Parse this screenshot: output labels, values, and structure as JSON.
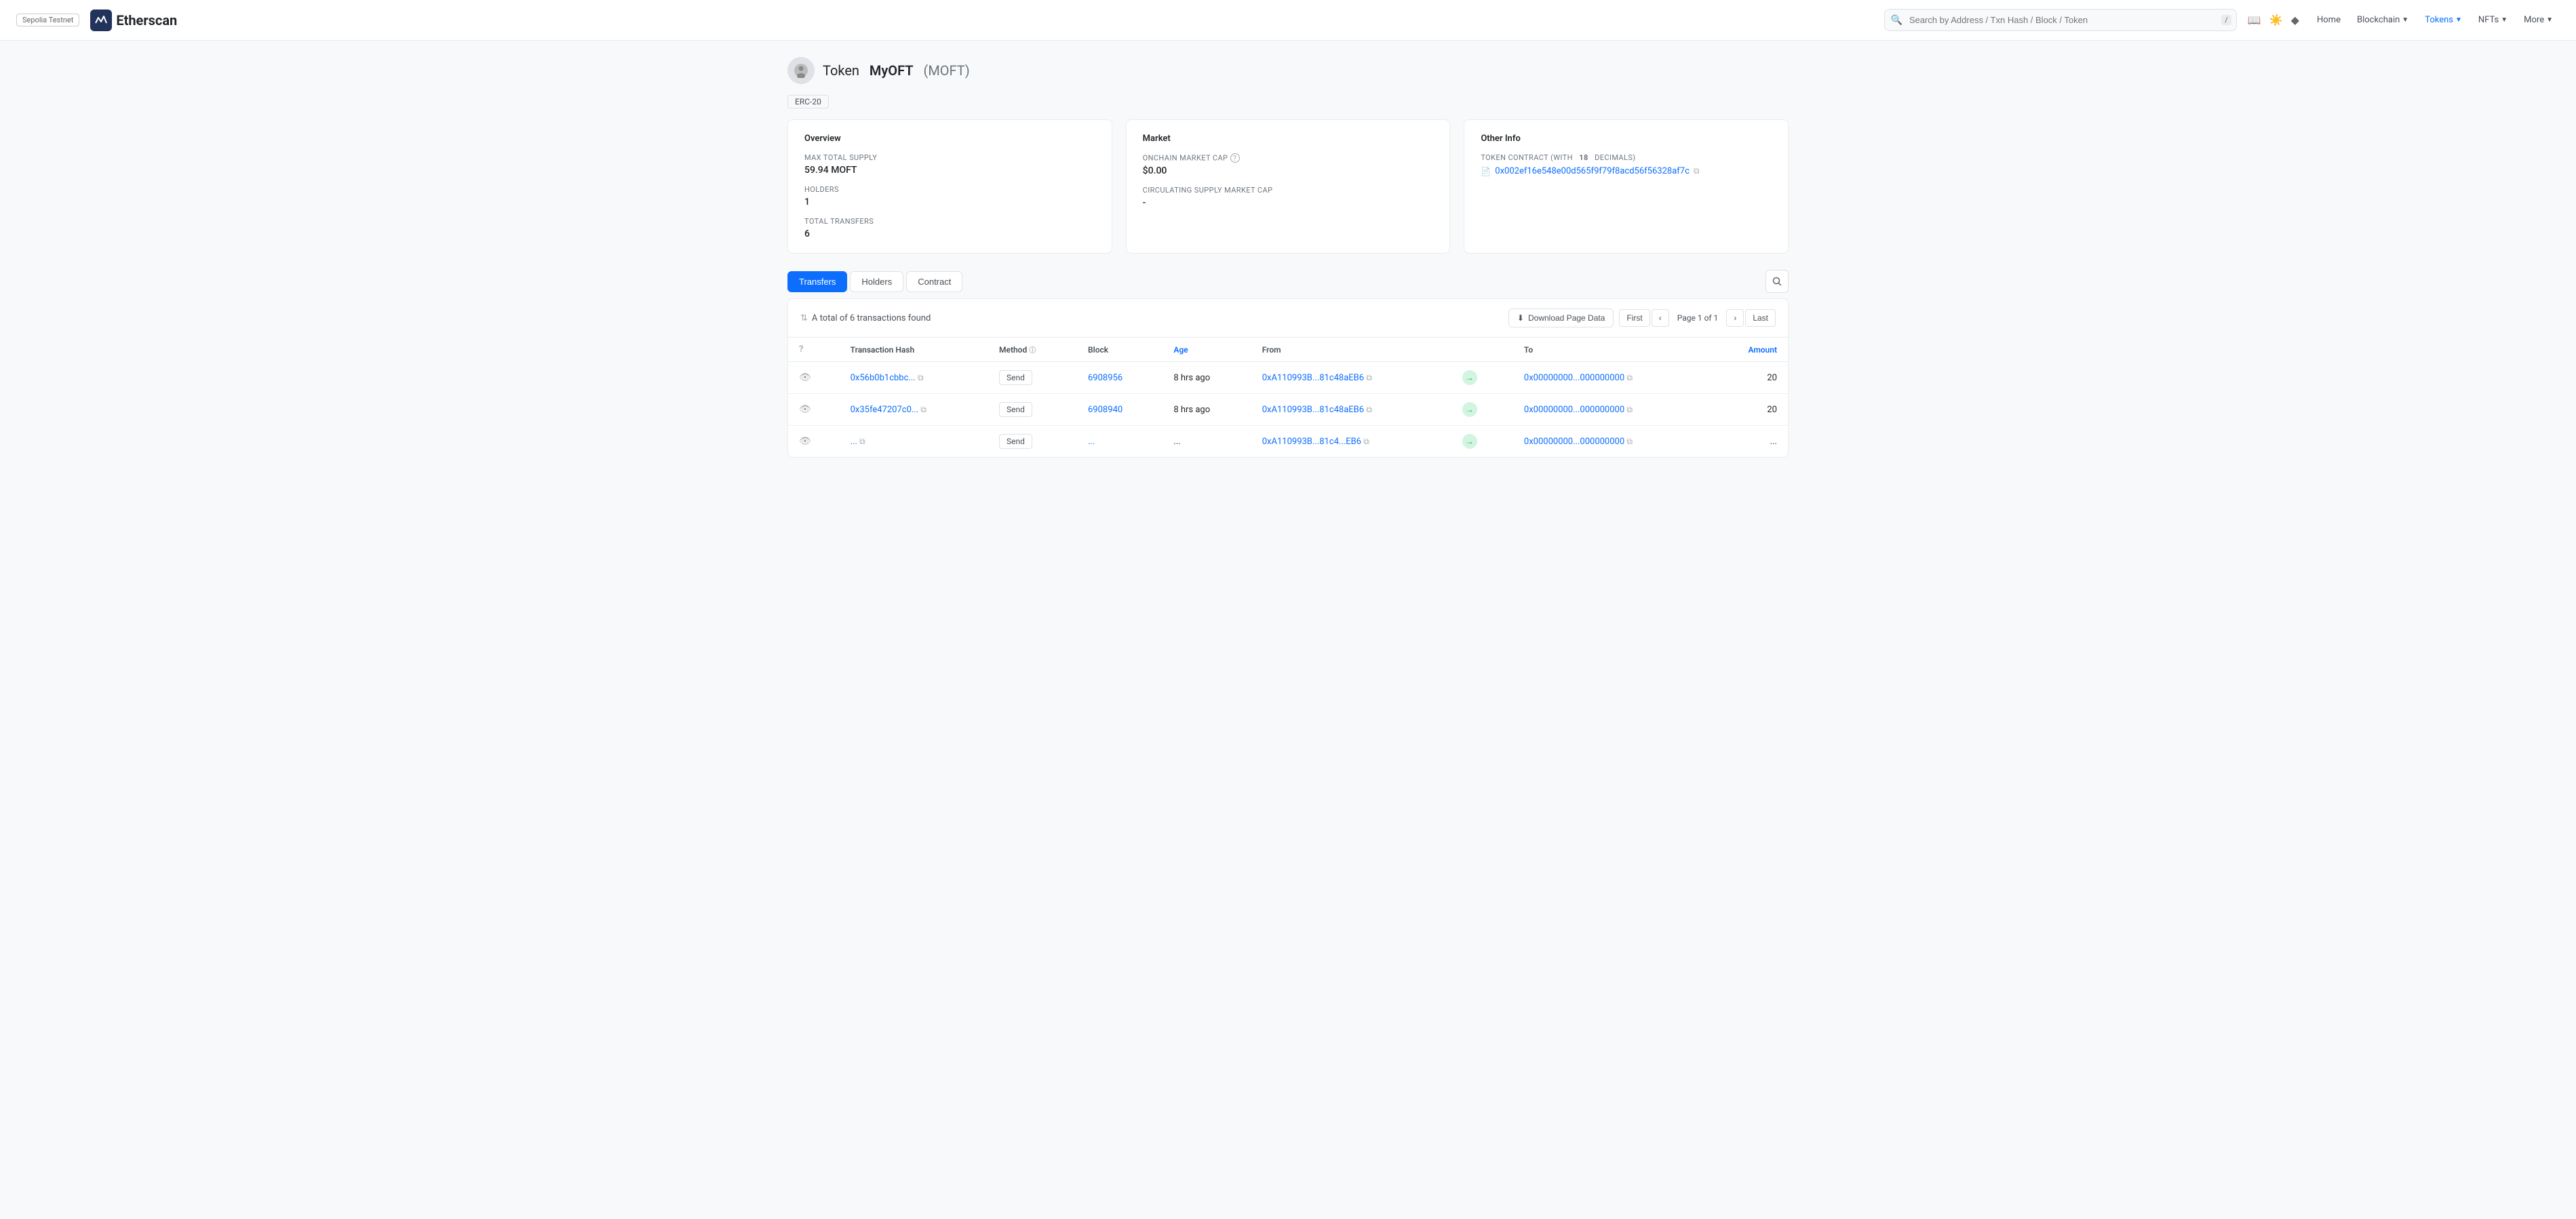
{
  "header": {
    "network": "Sepolia Testnet",
    "logo_text": "Etherscan",
    "search_placeholder": "Search by Address / Txn Hash / Block / Token",
    "slash_key": "/",
    "nav": [
      {
        "label": "Home",
        "active": false
      },
      {
        "label": "Blockchain",
        "has_dropdown": true,
        "active": false
      },
      {
        "label": "Tokens",
        "has_dropdown": true,
        "active": true
      },
      {
        "label": "NFTs",
        "has_dropdown": true,
        "active": false
      },
      {
        "label": "More",
        "has_dropdown": true,
        "active": false
      }
    ]
  },
  "token": {
    "title_prefix": "Token",
    "name": "MyOFT",
    "symbol": "(MOFT)",
    "badge": "ERC-20"
  },
  "overview_card": {
    "title": "Overview",
    "max_supply_label": "MAX TOTAL SUPPLY",
    "max_supply_value": "59.94 MOFT",
    "holders_label": "HOLDERS",
    "holders_value": "1",
    "transfers_label": "TOTAL TRANSFERS",
    "transfers_value": "6"
  },
  "market_card": {
    "title": "Market",
    "onchain_cap_label": "ONCHAIN MARKET CAP",
    "onchain_cap_value": "$0.00",
    "circulating_label": "CIRCULATING SUPPLY MARKET CAP",
    "circulating_value": "-"
  },
  "other_info_card": {
    "title": "Other Info",
    "contract_label": "TOKEN CONTRACT (WITH",
    "decimals_count": "18",
    "decimals_suffix": "DECIMALS)",
    "contract_address": "0x002ef16e548e00d565f9f79f8acd56f56328af7c"
  },
  "tabs": [
    {
      "label": "Transfers",
      "active": true
    },
    {
      "label": "Holders",
      "active": false
    },
    {
      "label": "Contract",
      "active": false
    }
  ],
  "table": {
    "total_info": "A total of 6 transactions found",
    "download_label": "Download Page Data",
    "pagination": {
      "first": "First",
      "prev": "‹",
      "page_info": "Page 1 of 1",
      "next": "›",
      "last": "Last"
    },
    "columns": [
      "",
      "Transaction Hash",
      "Method",
      "Block",
      "Age",
      "From",
      "",
      "To",
      "Amount"
    ],
    "rows": [
      {
        "hash": "0x56b0b1cbbc...",
        "method": "Send",
        "block": "6908956",
        "age": "8 hrs ago",
        "from": "0xA110993B...81c48aEB6",
        "to": "0x00000000...000000000",
        "amount": "20"
      },
      {
        "hash": "0x35fe47207c0...",
        "method": "Send",
        "block": "6908940",
        "age": "8 hrs ago",
        "from": "0xA110993B...81c48aEB6",
        "to": "0x00000000...000000000",
        "amount": "20"
      },
      {
        "hash": "...",
        "method": "Send",
        "block": "...",
        "age": "...",
        "from": "0xA110993B...81c4...EB6",
        "to": "0x00000000...000000000",
        "amount": "..."
      }
    ]
  }
}
